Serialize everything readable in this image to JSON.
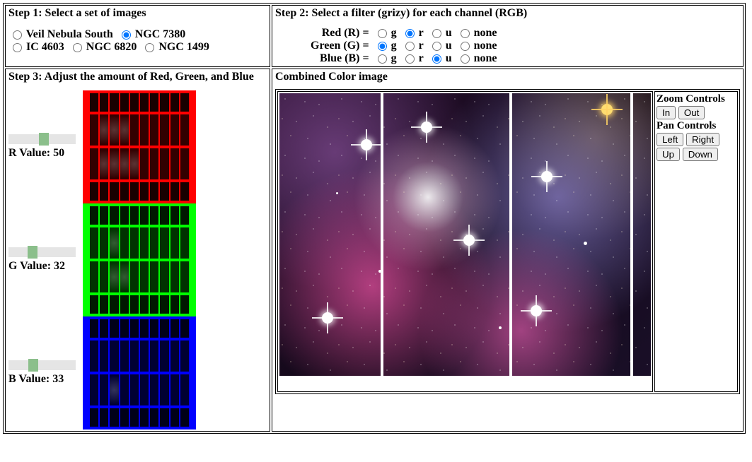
{
  "step1": {
    "title": "Step 1: Select a set of images",
    "options": [
      "Veil Nebula South",
      "NGC 7380",
      "IC 4603",
      "NGC 6820",
      "NGC 1499"
    ],
    "selected": "NGC 7380"
  },
  "step2": {
    "title": "Step 2: Select a filter (grizy) for each channel (RGB)",
    "rows": [
      {
        "label": "Red (R) =",
        "filters": [
          "g",
          "r",
          "u",
          "none"
        ],
        "selected": "r"
      },
      {
        "label": "Green (G) =",
        "filters": [
          "g",
          "r",
          "u",
          "none"
        ],
        "selected": "g"
      },
      {
        "label": "Blue (B) =",
        "filters": [
          "g",
          "r",
          "u",
          "none"
        ],
        "selected": "u"
      }
    ]
  },
  "step3": {
    "title": "Step 3: Adjust the amount of Red, Green, and Blue",
    "r": {
      "label": "R Value: 50",
      "value": 50
    },
    "g": {
      "label": "G Value: 32",
      "value": 32
    },
    "b": {
      "label": "B Value: 33",
      "value": 33
    }
  },
  "combined": {
    "title": "Combined Color image"
  },
  "controls": {
    "zoom_title": "Zoom Controls",
    "in": "In",
    "out": "Out",
    "pan_title": "Pan Controls",
    "left": "Left",
    "right": "Right",
    "up": "Up",
    "down": "Down"
  }
}
